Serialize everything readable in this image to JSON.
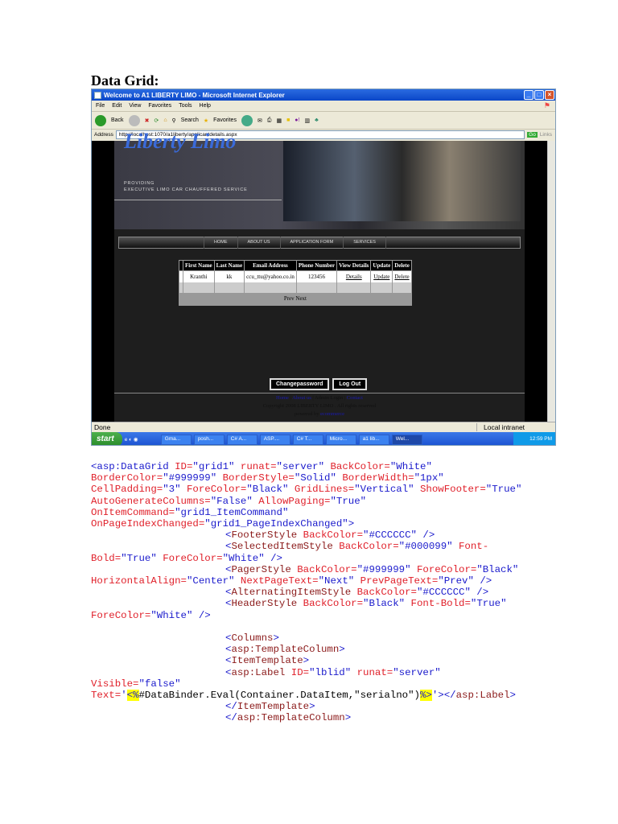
{
  "heading": "Data Grid:",
  "browser": {
    "title": "Welcome to A1 LIBERTY LIMO - Microsoft Internet Explorer",
    "menu": [
      "File",
      "Edit",
      "View",
      "Favorites",
      "Tools",
      "Help"
    ],
    "toolbar": {
      "back": "Back",
      "search": "Search",
      "favorites": "Favorites"
    },
    "address_label": "Address",
    "address": "http://localhost:1070/a1liberty/applicantdetails.aspx",
    "go": "Go",
    "links": "Links",
    "status": "Done",
    "zone": "Local intranet"
  },
  "site": {
    "logo": "Liberty Limo",
    "tagline1": "PROVIDING",
    "tagline2": "EXECUTIVE LIMO CAR CHAUFFERED SERVICE",
    "nav": [
      "HOME",
      "ABOUT US",
      "APPLICATION FORM",
      "SERVICES"
    ],
    "grid": {
      "headers": [
        "First Name",
        "Last Name",
        "Email Address",
        "Phone Number",
        "View Details",
        "Update",
        "Delete"
      ],
      "row": {
        "first": "Kranthi",
        "last": "kk",
        "email": "ccu_ttu@yahoo.co.in",
        "phone": "123456",
        "details": "Details",
        "update": "Update",
        "delete": "Delete"
      },
      "pager": "Prev Next"
    },
    "buttons": {
      "change": "Changepassword",
      "logout": "Log Out"
    },
    "footer": {
      "home": "Home",
      "about": "About us",
      "admin": "Admin Login",
      "contact": "Contact",
      "sep": " | ",
      "copyright": "Copyright 2008 LIBERTY LIMO . All rights reserved",
      "powered": "powered by ",
      "powered_link": "ecommerce"
    }
  },
  "taskbar": {
    "start": "start",
    "tasks": [
      "Gma...",
      "posh...",
      "C# A...",
      "ASP....",
      "C# T...",
      "Micro...",
      "a1 lib...",
      "Wel..."
    ],
    "clock": "12:59 PM"
  },
  "code": [
    {
      "i": 0,
      "s": [
        [
          "k",
          "<asp:DataGrid "
        ],
        [
          "a",
          "ID="
        ],
        [
          "v",
          "\"grid1\" "
        ],
        [
          "a",
          "runat="
        ],
        [
          "v",
          "\"server\" "
        ],
        [
          "a",
          "BackColor="
        ],
        [
          "v",
          "\"White\""
        ]
      ]
    },
    {
      "i": 0,
      "s": [
        [
          "a",
          "BorderColor="
        ],
        [
          "v",
          "\"#999999\" "
        ],
        [
          "a",
          "BorderStyle="
        ],
        [
          "v",
          "\"Solid\" "
        ],
        [
          "a",
          "BorderWidth="
        ],
        [
          "v",
          "\"1px\""
        ]
      ]
    },
    {
      "i": 0,
      "s": [
        [
          "a",
          "CellPadding="
        ],
        [
          "v",
          "\"3\" "
        ],
        [
          "a",
          "ForeColor="
        ],
        [
          "v",
          "\"Black\" "
        ],
        [
          "a",
          "GridLines="
        ],
        [
          "v",
          "\"Vertical\" "
        ],
        [
          "a",
          "ShowFooter="
        ],
        [
          "v",
          "\"True\""
        ]
      ]
    },
    {
      "i": 0,
      "s": [
        [
          "a",
          "AutoGenerateColumns="
        ],
        [
          "v",
          "\"False\" "
        ],
        [
          "a",
          "AllowPaging="
        ],
        [
          "v",
          "\"True\""
        ]
      ]
    },
    {
      "i": 0,
      "s": [
        [
          "a",
          "OnItemCommand="
        ],
        [
          "v",
          "\"grid1_ItemCommand\""
        ]
      ]
    },
    {
      "i": 0,
      "s": [
        [
          "a",
          "OnPageIndexChanged="
        ],
        [
          "v",
          "\"grid1_PageIndexChanged\">"
        ]
      ]
    },
    {
      "i": 1,
      "s": [
        [
          "k",
          "<"
        ],
        [
          "t",
          "FooterStyle "
        ],
        [
          "a",
          "BackColor="
        ],
        [
          "v",
          "\"#CCCCCC\" />"
        ]
      ]
    },
    {
      "i": 1,
      "s": [
        [
          "k",
          "<"
        ],
        [
          "t",
          "SelectedItemStyle "
        ],
        [
          "a",
          "BackColor="
        ],
        [
          "v",
          "\"#000099\" "
        ],
        [
          "a",
          "Font-"
        ]
      ]
    },
    {
      "i": 0,
      "s": [
        [
          "a",
          "Bold="
        ],
        [
          "v",
          "\"True\" "
        ],
        [
          "a",
          "ForeColor="
        ],
        [
          "v",
          "\"White\" />"
        ]
      ]
    },
    {
      "i": 1,
      "s": [
        [
          "k",
          "<"
        ],
        [
          "t",
          "PagerStyle "
        ],
        [
          "a",
          "BackColor="
        ],
        [
          "v",
          "\"#999999\" "
        ],
        [
          "a",
          "ForeColor="
        ],
        [
          "v",
          "\"Black\""
        ]
      ]
    },
    {
      "i": 0,
      "s": [
        [
          "a",
          "HorizontalAlign="
        ],
        [
          "v",
          "\"Center\" "
        ],
        [
          "a",
          "NextPageText="
        ],
        [
          "v",
          "\"Next\" "
        ],
        [
          "a",
          "PrevPageText="
        ],
        [
          "v",
          "\"Prev\" />"
        ]
      ]
    },
    {
      "i": 1,
      "s": [
        [
          "k",
          "<"
        ],
        [
          "t",
          "AlternatingItemStyle "
        ],
        [
          "a",
          "BackColor="
        ],
        [
          "v",
          "\"#CCCCCC\" />"
        ]
      ]
    },
    {
      "i": 1,
      "s": [
        [
          "k",
          "<"
        ],
        [
          "t",
          "HeaderStyle "
        ],
        [
          "a",
          "BackColor="
        ],
        [
          "v",
          "\"Black\" "
        ],
        [
          "a",
          "Font-Bold="
        ],
        [
          "v",
          "\"True\""
        ]
      ]
    },
    {
      "i": 0,
      "s": [
        [
          "a",
          "ForeColor="
        ],
        [
          "v",
          "\"White\" />"
        ]
      ]
    },
    {
      "i": 0,
      "s": [
        [
          "p",
          " "
        ]
      ]
    },
    {
      "i": 1,
      "s": [
        [
          "k",
          "<"
        ],
        [
          "t",
          "Columns"
        ],
        [
          "k",
          ">"
        ]
      ]
    },
    {
      "i": 1,
      "s": [
        [
          "k",
          "<"
        ],
        [
          "t",
          "asp:TemplateColumn"
        ],
        [
          "k",
          ">"
        ]
      ]
    },
    {
      "i": 1,
      "s": [
        [
          "k",
          "<"
        ],
        [
          "t",
          "ItemTemplate"
        ],
        [
          "k",
          ">"
        ]
      ]
    },
    {
      "i": 1,
      "s": [
        [
          "k",
          "<"
        ],
        [
          "t",
          "asp:Label "
        ],
        [
          "a",
          "ID="
        ],
        [
          "v",
          "\"lblid\" "
        ],
        [
          "a",
          "runat="
        ],
        [
          "v",
          "\"server\""
        ]
      ]
    },
    {
      "i": 0,
      "s": [
        [
          "a",
          "Visible="
        ],
        [
          "v",
          "\"false\""
        ]
      ]
    },
    {
      "i": 0,
      "s": [
        [
          "a",
          "Text="
        ],
        [
          "v",
          "'"
        ],
        [
          "h",
          "<%"
        ],
        [
          "p",
          "#DataBinder.Eval(Container.DataItem,\"serialno\")"
        ],
        [
          "h",
          "%>"
        ],
        [
          "v",
          "'></"
        ],
        [
          "t",
          "asp:Label"
        ],
        [
          "k",
          ">"
        ]
      ]
    },
    {
      "i": 1,
      "s": [
        [
          "k",
          "</"
        ],
        [
          "t",
          "ItemTemplate"
        ],
        [
          "k",
          ">"
        ]
      ]
    },
    {
      "i": 1,
      "s": [
        [
          "k",
          "</"
        ],
        [
          "t",
          "asp:TemplateColumn"
        ],
        [
          "k",
          ">"
        ]
      ]
    }
  ]
}
